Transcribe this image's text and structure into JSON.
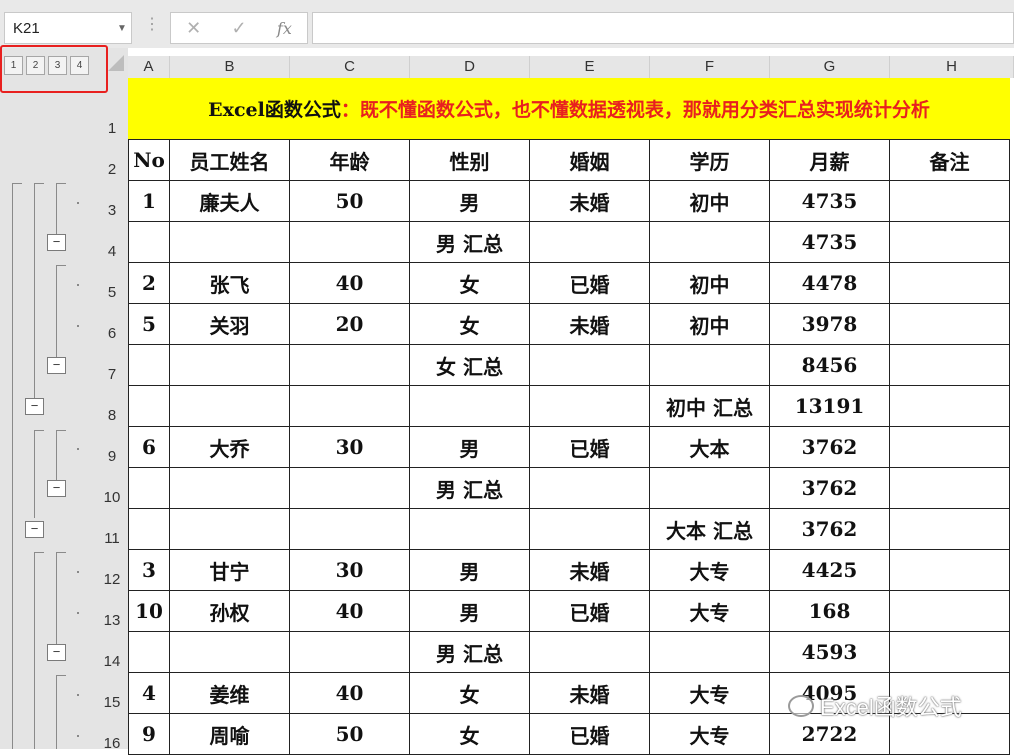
{
  "namebox": {
    "value": "K21"
  },
  "formula_bar": {
    "cancel_icon": "✕",
    "enter_icon": "✓",
    "fx_label": "fx",
    "value": ""
  },
  "outline": {
    "levels": [
      "1",
      "2",
      "3",
      "4"
    ],
    "collapse_symbol": "−"
  },
  "columns": [
    "A",
    "B",
    "C",
    "D",
    "E",
    "F",
    "G",
    "H"
  ],
  "row_numbers": [
    "1",
    "2",
    "3",
    "4",
    "5",
    "6",
    "7",
    "8",
    "9",
    "10",
    "11",
    "12",
    "13",
    "14",
    "15",
    "16"
  ],
  "title": {
    "black": "Excel函数公式",
    "red": "：既不懂函数公式，也不懂数据透视表，那就用分类汇总实现统计分析"
  },
  "header": [
    "No",
    "员工姓名",
    "年龄",
    "性别",
    "婚姻",
    "学历",
    "月薪",
    "备注"
  ],
  "rows": [
    [
      "1",
      "廉夫人",
      "50",
      "男",
      "未婚",
      "初中",
      "4735",
      ""
    ],
    [
      "",
      "",
      "",
      "男 汇总",
      "",
      "",
      "4735",
      ""
    ],
    [
      "2",
      "张飞",
      "40",
      "女",
      "已婚",
      "初中",
      "4478",
      ""
    ],
    [
      "5",
      "关羽",
      "20",
      "女",
      "未婚",
      "初中",
      "3978",
      ""
    ],
    [
      "",
      "",
      "",
      "女 汇总",
      "",
      "",
      "8456",
      ""
    ],
    [
      "",
      "",
      "",
      "",
      "",
      "初中 汇总",
      "13191",
      ""
    ],
    [
      "6",
      "大乔",
      "30",
      "男",
      "已婚",
      "大本",
      "3762",
      ""
    ],
    [
      "",
      "",
      "",
      "男 汇总",
      "",
      "",
      "3762",
      ""
    ],
    [
      "",
      "",
      "",
      "",
      "",
      "大本 汇总",
      "3762",
      ""
    ],
    [
      "3",
      "甘宁",
      "30",
      "男",
      "未婚",
      "大专",
      "4425",
      ""
    ],
    [
      "10",
      "孙权",
      "40",
      "男",
      "已婚",
      "大专",
      "168",
      ""
    ],
    [
      "",
      "",
      "",
      "男 汇总",
      "",
      "",
      "4593",
      ""
    ],
    [
      "4",
      "姜维",
      "40",
      "女",
      "未婚",
      "大专",
      "4095",
      ""
    ],
    [
      "9",
      "周喻",
      "50",
      "女",
      "已婚",
      "大专",
      "2722",
      ""
    ]
  ],
  "watermark": "Excel函数公式",
  "colors": {
    "title_bg": "#ffff00",
    "title_red": "#e8201f",
    "highlight_box": "#e8201f"
  }
}
